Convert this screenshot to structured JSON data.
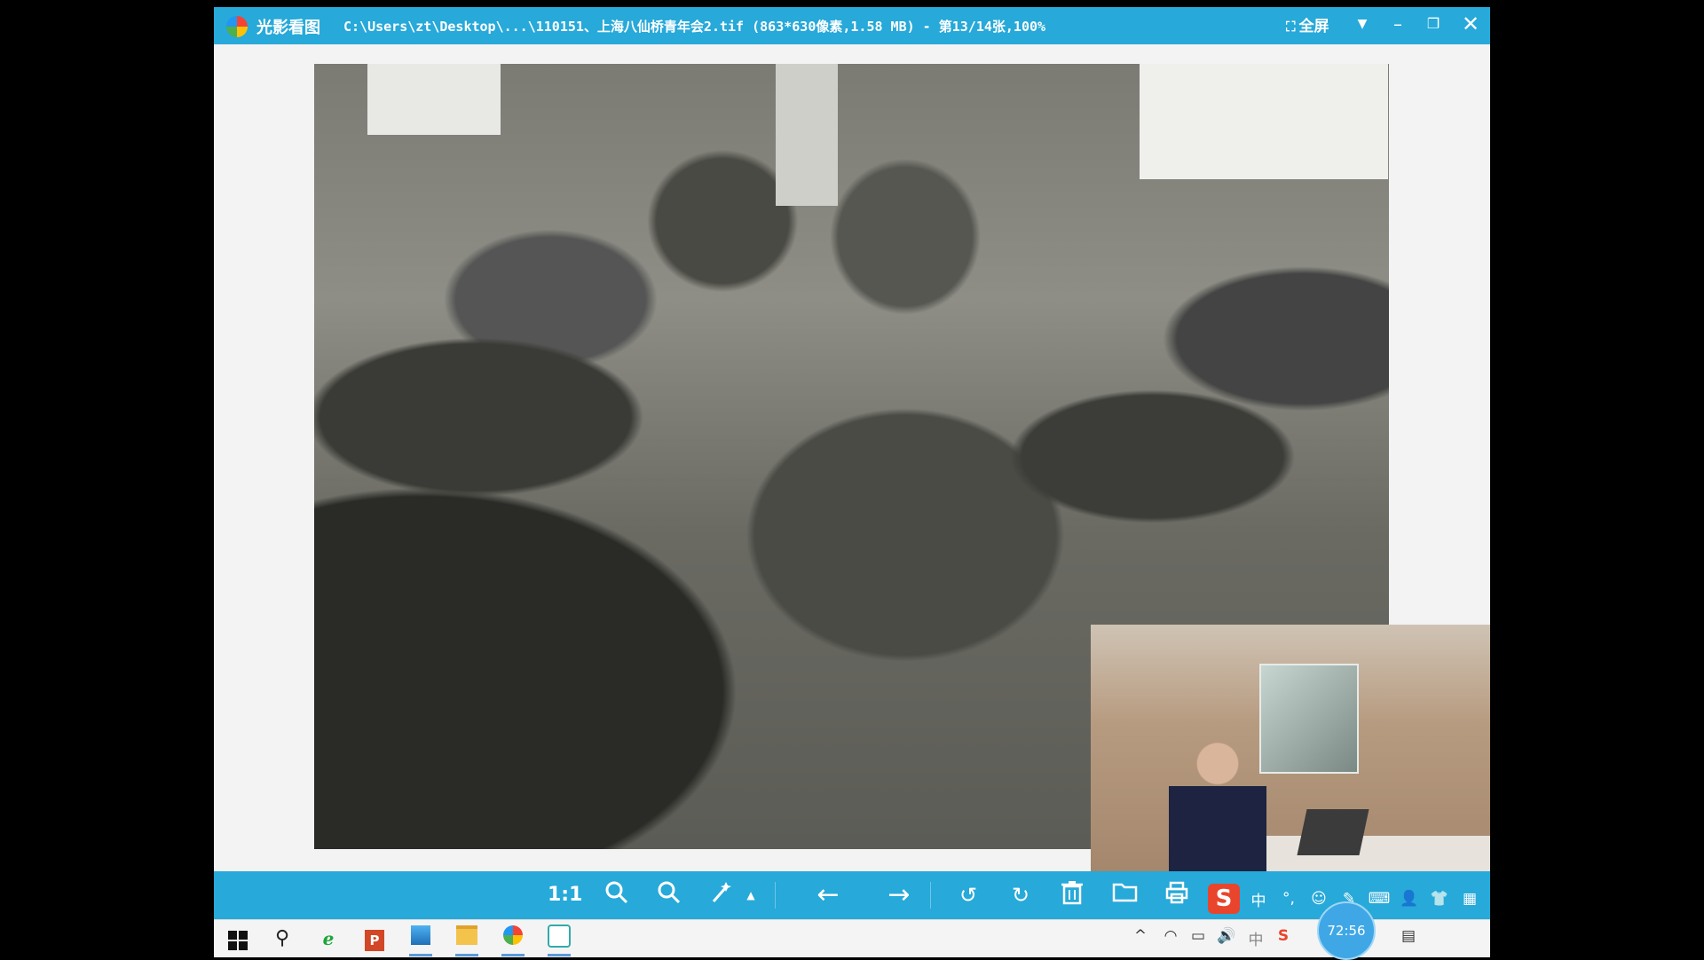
{
  "titlebar": {
    "app_name": "光影看图",
    "title": "C:\\Users\\zt\\Desktop\\...\\110151、上海八仙桥青年会2.tif (863*630像素,1.58 MB) - 第13/14张,100%",
    "fullscreen_label": "全屏"
  },
  "toolbar": {
    "ratio_label": "1:1"
  },
  "ime": {
    "logo": "S",
    "lang_label": "中"
  },
  "tray": {
    "ime_label": "中",
    "sogou_label": "S"
  },
  "overlay": {
    "timer": "72:56"
  },
  "icons": {
    "zoom_in": "zoom-in-icon",
    "zoom_out": "zoom-out-icon",
    "edit": "magic-wand-icon",
    "prev": "arrow-left-icon",
    "next": "arrow-right-icon",
    "rotate_left": "rotate-left-icon",
    "rotate_right": "rotate-right-icon",
    "delete": "trash-icon",
    "open": "folder-icon",
    "print": "print-icon"
  },
  "colors": {
    "accent": "#27a9d9",
    "background": "#000000",
    "viewer_bg": "#f3f3f3"
  }
}
